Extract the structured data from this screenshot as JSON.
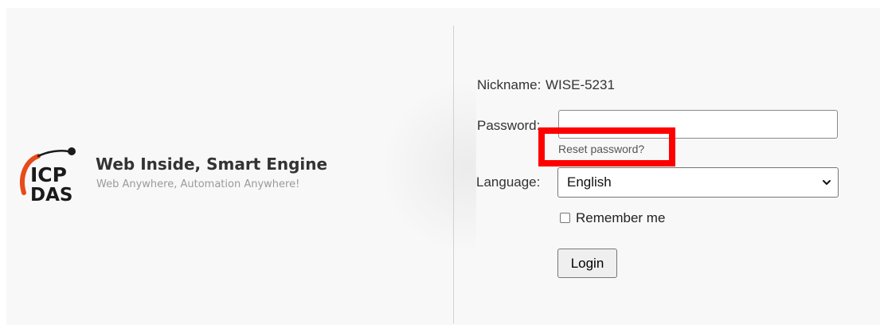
{
  "brand": {
    "logo_top": "ICP",
    "logo_bottom": "DAS",
    "title": "Web Inside, Smart Engine",
    "subtitle": "Web Anywhere, Automation Anywhere!",
    "logo_color": "#1a1a1a",
    "logo_accent": "#e84a1a"
  },
  "login": {
    "nickname_label": "Nickname:",
    "nickname_value": "WISE-5231",
    "password_label": "Password:",
    "password_value": "",
    "reset_link": "Reset password?",
    "language_label": "Language:",
    "language_selected": "English",
    "remember_label": "Remember me",
    "remember_checked": false,
    "login_button": "Login"
  },
  "annotation": {
    "highlight_color": "#ff0000"
  }
}
